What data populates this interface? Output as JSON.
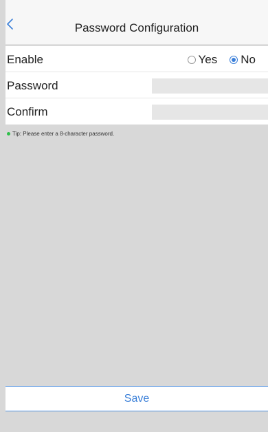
{
  "header": {
    "title": "Password Configuration",
    "back_icon": "chevron-left-icon"
  },
  "form": {
    "enable": {
      "label": "Enable",
      "options": [
        {
          "label": "Yes",
          "selected": false
        },
        {
          "label": "No",
          "selected": true
        }
      ]
    },
    "password": {
      "label": "Password",
      "value": ""
    },
    "confirm": {
      "label": "Confirm",
      "value": ""
    }
  },
  "tip": {
    "text": "Tip: Please enter a 8-character password.",
    "dot_color": "#2fbf4a"
  },
  "footer": {
    "save_label": "Save"
  },
  "colors": {
    "accent": "#3a7fd8",
    "background": "#d8d8d8"
  }
}
